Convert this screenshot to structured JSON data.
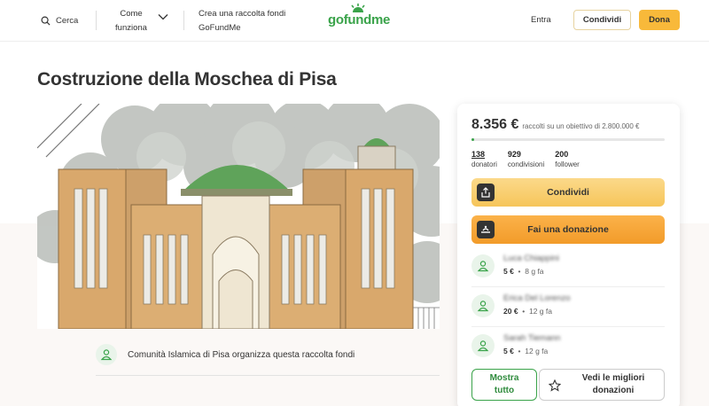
{
  "header": {
    "search_label": "Cerca",
    "how_it_works": "Come funziona",
    "create_fundraiser": "Crea una raccolta fondi GoFundMe",
    "logo_text": "gofundme",
    "login": "Entra",
    "share_button": "Condividi",
    "donate_button": "Dona",
    "icons": [
      "search-icon",
      "chevron-down-icon"
    ]
  },
  "campaign": {
    "title": "Costruzione della Moschea di Pisa",
    "organizer_text": "Comunità Islamica di Pisa organizza questa raccolta fondi"
  },
  "sidebar": {
    "raised_amount": "8.356 €",
    "raised_text": "raccolti su un obiettivo di 2.800.000 €",
    "progress_fraction": 0.003,
    "stats": [
      {
        "value": "138",
        "label": "donatori"
      },
      {
        "value": "929",
        "label": "condivisioni"
      },
      {
        "value": "200",
        "label": "follower"
      }
    ],
    "share_button": "Condividi",
    "donate_button": "Fai una donazione",
    "donations": [
      {
        "name": "Luca Chiappini",
        "amount": "5 €",
        "time": "8 g fa"
      },
      {
        "name": "Erica Del Lorenzo",
        "amount": "20 €",
        "time": "12 g fa"
      },
      {
        "name": "Sarah Tiemann",
        "amount": "5 €",
        "time": "12 g fa"
      }
    ],
    "see_all_button": "Mostra tutto",
    "top_donations_button": "Vedi le migliori donazioni"
  },
  "colors": {
    "brand_green": "#3aa34a",
    "accent_yellow": "#f8b93a",
    "donate_orange": "#f29b2a"
  }
}
